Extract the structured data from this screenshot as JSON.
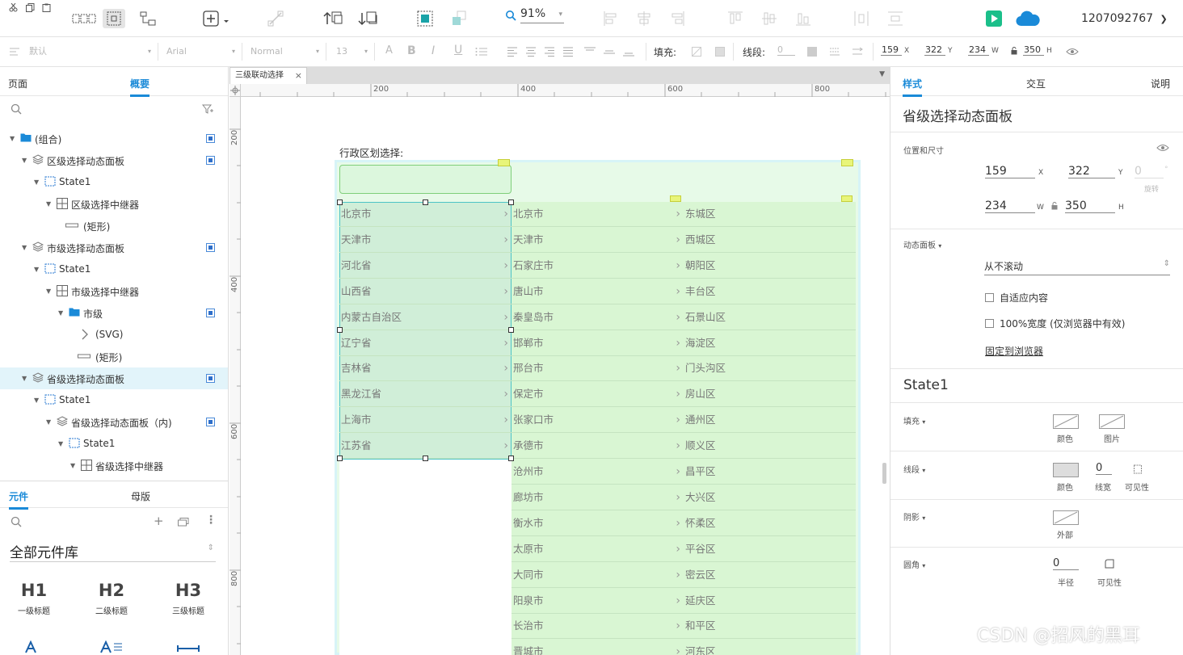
{
  "toolbar": {
    "zoom": "91%",
    "user_id": "1207092767"
  },
  "format_bar": {
    "style": "默认",
    "font": "Arial",
    "weight": "Normal",
    "size": "13",
    "fill_label": "填充:",
    "line_label": "线段:",
    "line_value": "0",
    "x": "159",
    "x_label": "X",
    "y": "322",
    "y_label": "Y",
    "w": "234",
    "w_label": "W",
    "h": "350",
    "h_label": "H"
  },
  "left_panel": {
    "tabs": [
      "页面",
      "概要"
    ],
    "outline": [
      {
        "label": "(组合)",
        "level": 0,
        "icon": "folder"
      },
      {
        "label": "区级选择动态面板",
        "level": 1,
        "icon": "layers"
      },
      {
        "label": "State1",
        "level": 2,
        "icon": "state"
      },
      {
        "label": "区级选择中继器",
        "level": 3,
        "icon": "grid"
      },
      {
        "label": "(矩形)",
        "level": 4,
        "icon": "rect"
      },
      {
        "label": "市级选择动态面板",
        "level": 1,
        "icon": "layers"
      },
      {
        "label": "State1",
        "level": 2,
        "icon": "state"
      },
      {
        "label": "市级选择中继器",
        "level": 3,
        "icon": "grid"
      },
      {
        "label": "市级",
        "level": 4,
        "icon": "folder"
      },
      {
        "label": "(SVG)",
        "level": 5,
        "icon": "svg"
      },
      {
        "label": "(矩形)",
        "level": 5,
        "icon": "rect"
      },
      {
        "label": "省级选择动态面板",
        "level": 1,
        "icon": "layers"
      },
      {
        "label": "State1",
        "level": 2,
        "icon": "state"
      },
      {
        "label": "省级选择动态面板（内)",
        "level": 3,
        "icon": "layers"
      },
      {
        "label": "State1",
        "level": 4,
        "icon": "state"
      },
      {
        "label": "省级选择中继器",
        "level": 5,
        "icon": "grid"
      }
    ],
    "lib_tabs": [
      "元件",
      "母版"
    ],
    "library_name": "全部元件库",
    "widgets": [
      {
        "glyph": "H1",
        "label": "一级标题"
      },
      {
        "glyph": "H2",
        "label": "二级标题"
      },
      {
        "glyph": "H3",
        "label": "三级标题"
      }
    ]
  },
  "canvas": {
    "doc_tab": "三级联动选择",
    "ruler_h": [
      "200",
      "400",
      "600",
      "800"
    ],
    "ruler_v": [
      "200",
      "400",
      "600",
      "800"
    ],
    "heading": "行政区划选择:",
    "provinces": [
      "北京市",
      "天津市",
      "河北省",
      "山西省",
      "内蒙古自治区",
      "辽宁省",
      "吉林省",
      "黑龙江省",
      "上海市",
      "江苏省"
    ],
    "cities": [
      "北京市",
      "天津市",
      "石家庄市",
      "唐山市",
      "秦皇岛市",
      "邯郸市",
      "邢台市",
      "保定市",
      "张家口市",
      "承德市",
      "沧州市",
      "廊坊市",
      "衡水市",
      "太原市",
      "大同市",
      "阳泉市",
      "长治市",
      "晋城市"
    ],
    "districts": [
      "东城区",
      "西城区",
      "朝阳区",
      "丰台区",
      "石景山区",
      "海淀区",
      "门头沟区",
      "房山区",
      "通州区",
      "顺义区",
      "昌平区",
      "大兴区",
      "怀柔区",
      "平谷区",
      "密云区",
      "延庆区",
      "和平区",
      "河东区"
    ]
  },
  "right_panel": {
    "tabs": [
      "样式",
      "交互",
      "说明"
    ],
    "title": "省级选择动态面板",
    "pos_size_label": "位置和尺寸",
    "x": "159",
    "x_label": "X",
    "y": "322",
    "y_label": "Y",
    "rot": "0",
    "rot_unit": "°",
    "rot_label": "旋转",
    "w": "234",
    "w_label": "W",
    "h": "350",
    "h_label": "H",
    "dyn_label": "动态面板",
    "scroll_value": "从不滚动",
    "fit_content": "自适应内容",
    "full_width": "100%宽度 (仅浏览器中有效)",
    "pin_browser": "固定到浏览器",
    "state_title": "State1",
    "fill_label": "填充",
    "fill_color": "颜色",
    "fill_image": "图片",
    "line_label": "线段",
    "line_color": "颜色",
    "line_width": "0",
    "line_width_label": "线宽",
    "line_visible": "可见性",
    "shadow_label": "阴影",
    "shadow_outer": "外部",
    "radius_label": "圆角",
    "radius_value": "0",
    "radius_sub": "半径",
    "radius_visible": "可见性"
  },
  "watermark": "CSDN @招风的黑耳"
}
